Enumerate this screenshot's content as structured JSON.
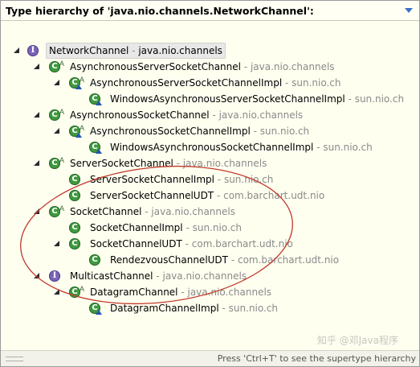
{
  "header": {
    "title": "Type hierarchy of 'java.nio.channels.NetworkChannel':"
  },
  "tree": {
    "rows": [
      {
        "name": "NetworkChannel",
        "sep": " - ",
        "pkg": "java.nio.channels"
      },
      {
        "name": "AsynchronousServerSocketChannel",
        "sep": " - ",
        "pkg": "java.nio.channels"
      },
      {
        "name": "AsynchronousServerSocketChannelImpl",
        "sep": " - ",
        "pkg": "sun.nio.ch"
      },
      {
        "name": "WindowsAsynchronousServerSocketChannelImpl",
        "sep": " - ",
        "pkg": "sun.nio.ch"
      },
      {
        "name": "AsynchronousSocketChannel",
        "sep": " - ",
        "pkg": "java.nio.channels"
      },
      {
        "name": "AsynchronousSocketChannelImpl",
        "sep": " - ",
        "pkg": "sun.nio.ch"
      },
      {
        "name": "WindowsAsynchronousSocketChannelImpl",
        "sep": " - ",
        "pkg": "sun.nio.ch"
      },
      {
        "name": "ServerSocketChannel",
        "sep": " - ",
        "pkg": "java.nio.channels"
      },
      {
        "name": "ServerSocketChannelImpl",
        "sep": " - ",
        "pkg": "sun.nio.ch"
      },
      {
        "name": "ServerSocketChannelUDT",
        "sep": " - ",
        "pkg": "com.barchart.udt.nio"
      },
      {
        "name": "SocketChannel",
        "sep": " - ",
        "pkg": "java.nio.channels"
      },
      {
        "name": "SocketChannelImpl",
        "sep": " - ",
        "pkg": "sun.nio.ch"
      },
      {
        "name": "SocketChannelUDT",
        "sep": " - ",
        "pkg": "com.barchart.udt.nio"
      },
      {
        "name": "RendezvousChannelUDT",
        "sep": " - ",
        "pkg": "com.barchart.udt.nio"
      },
      {
        "name": "MulticastChannel",
        "sep": " - ",
        "pkg": "java.nio.channels"
      },
      {
        "name": "DatagramChannel",
        "sep": " - ",
        "pkg": "java.nio.channels"
      },
      {
        "name": "DatagramChannelImpl",
        "sep": " - ",
        "pkg": "sun.nio.ch"
      }
    ]
  },
  "status": {
    "text": "Press 'Ctrl+T' to see the supertype hierarchy"
  },
  "watermark": "知乎 @邓Java程序",
  "colors": {
    "class_icon": "#3f9a3f",
    "interface_icon": "#7a64b8",
    "package_text": "#8a8a8a",
    "annotation_ellipse": "#c0392b"
  }
}
